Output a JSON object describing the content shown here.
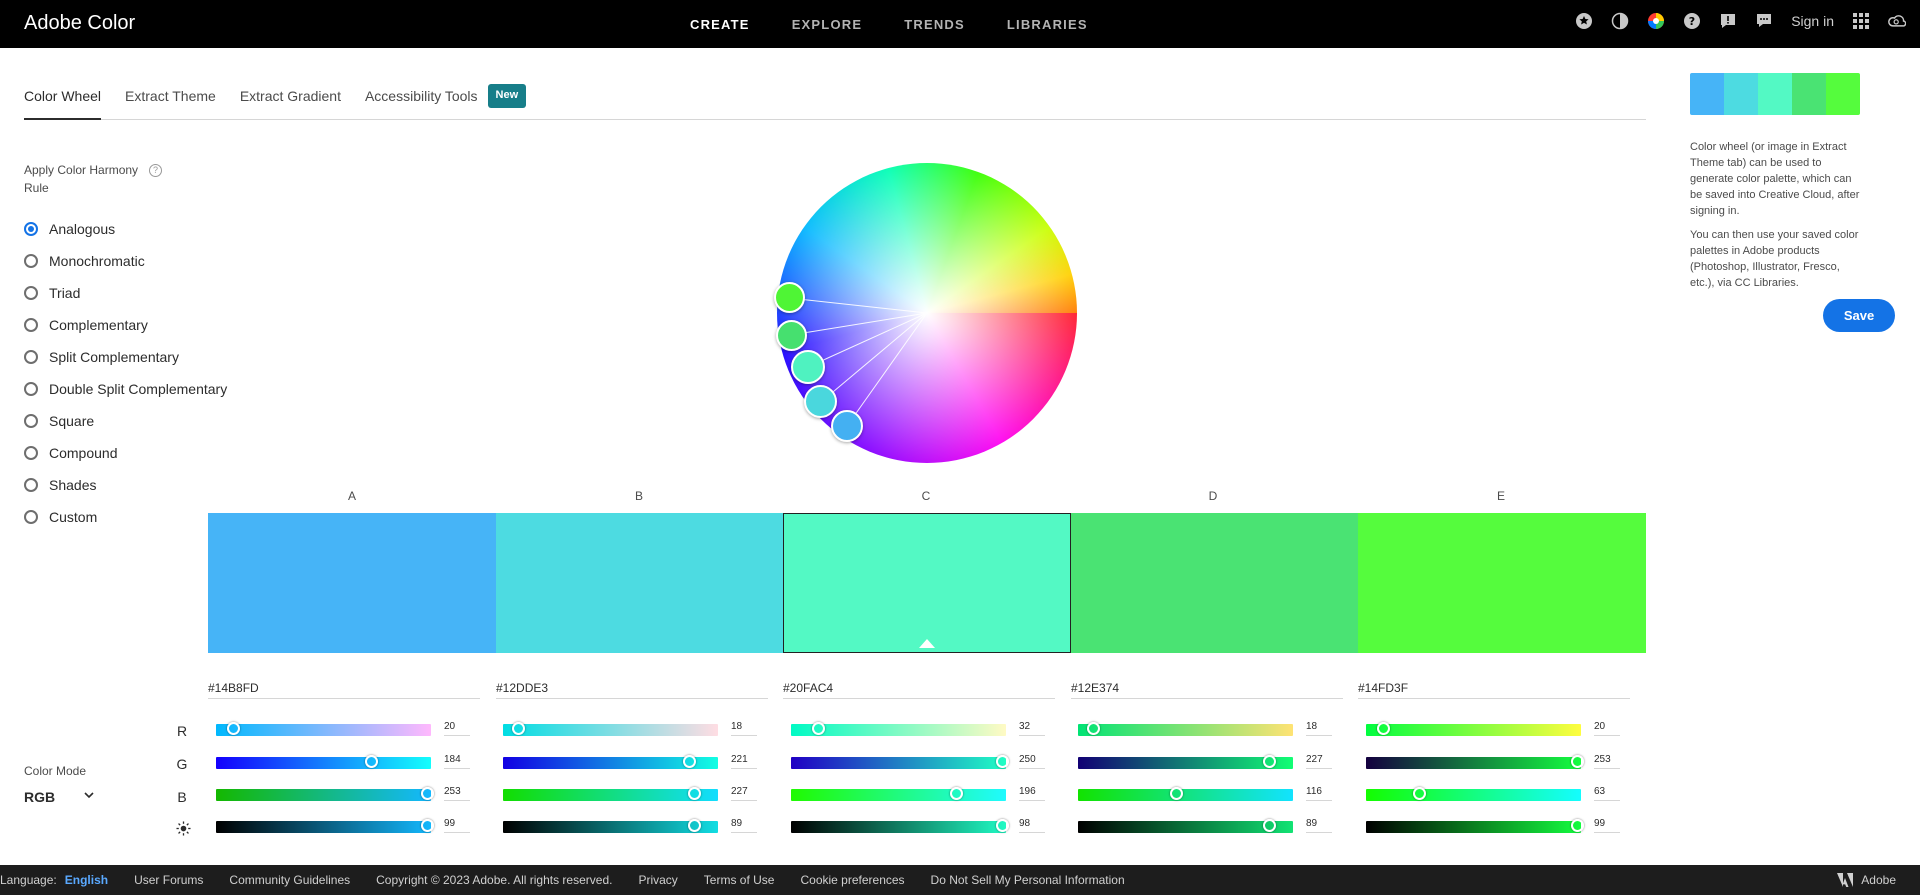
{
  "app": {
    "brand": "Adobe Color"
  },
  "nav": {
    "items": [
      "CREATE",
      "EXPLORE",
      "TRENDS",
      "LIBRARIES"
    ],
    "active": "CREATE"
  },
  "top_icons": [
    "star-icon",
    "contrast-icon",
    "color-wheel-icon",
    "help-icon",
    "feedback-icon",
    "chat-icon"
  ],
  "signin": "Sign in",
  "tabs": [
    {
      "label": "Color Wheel",
      "active": true
    },
    {
      "label": "Extract Theme"
    },
    {
      "label": "Extract Gradient"
    },
    {
      "label": "Accessibility Tools"
    }
  ],
  "new_badge": "New",
  "harmony": {
    "title": "Apply Color Harmony Rule",
    "help": "?",
    "rules": [
      "Analogous",
      "Monochromatic",
      "Triad",
      "Complementary",
      "Split Complementary",
      "Double Split Complementary",
      "Square",
      "Compound",
      "Shades",
      "Custom"
    ],
    "selected": "Analogous"
  },
  "swatches": [
    {
      "label": "A",
      "hex": "#14B8FD",
      "color": "#46b4f7",
      "rgb": [
        20,
        184,
        253
      ],
      "brightness": 99
    },
    {
      "label": "B",
      "hex": "#12DDE3",
      "color": "#4ddbe1",
      "rgb": [
        18,
        221,
        227
      ],
      "brightness": 89
    },
    {
      "label": "C",
      "hex": "#20FAC4",
      "color": "#53f9c4",
      "rgb": [
        32,
        250,
        196
      ],
      "brightness": 98,
      "selected": true
    },
    {
      "label": "D",
      "hex": "#12E374",
      "color": "#4ae373",
      "rgb": [
        18,
        227,
        116
      ],
      "brightness": 89
    },
    {
      "label": "E",
      "hex": "#14FD3F",
      "color": "#55fc3d",
      "rgb": [
        20,
        253,
        63
      ],
      "brightness": 99
    }
  ],
  "channels": [
    "R",
    "G",
    "B"
  ],
  "color_mode": {
    "label": "Color Mode",
    "value": "RGB"
  },
  "side_info": {
    "p1": "Color wheel (or image in Extract Theme tab) can be used to generate color palette, which can be saved into Creative Cloud, after signing in.",
    "p2": "You can then use your saved color palettes in Adobe products (Photoshop, Illustrator, Fresco, etc.), via CC Libraries."
  },
  "save_label": "Save",
  "footer": {
    "language_label": "Language:",
    "language": "English",
    "links": [
      "User Forums",
      "Community Guidelines",
      "Copyright © 2023 Adobe. All rights reserved.",
      "Privacy",
      "Terms of Use",
      "Cookie preferences",
      "Do Not Sell My Personal Information"
    ],
    "adobe": "Adobe"
  }
}
